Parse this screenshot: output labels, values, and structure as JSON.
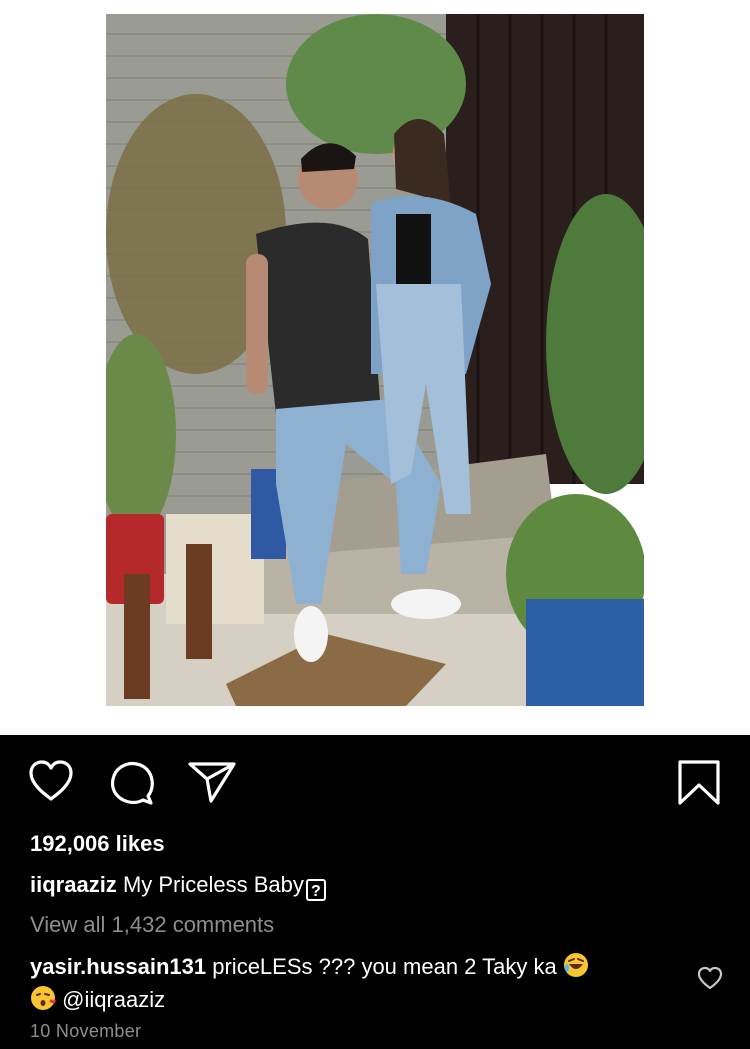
{
  "post": {
    "likes": "192,006 likes",
    "caption_username": "iiqraaziz",
    "caption_text": "My Priceless Baby",
    "caption_glyph": "?",
    "view_comments": "View all 1,432 comments",
    "comment": {
      "username": "yasir.hussain131",
      "text_part1": "priceLESs ??? you mean 2 Taky ka",
      "mention": "@iiqraaziz"
    },
    "timestamp": "10 November"
  },
  "icons": {
    "like": "heart-outline-icon",
    "comment": "speech-bubble-icon",
    "share": "paper-plane-icon",
    "save": "bookmark-icon",
    "comment_like": "small-heart-icon"
  },
  "colors": {
    "footer_bg": "#000000",
    "text_primary": "#ffffff",
    "text_secondary": "#8e8e8e"
  }
}
